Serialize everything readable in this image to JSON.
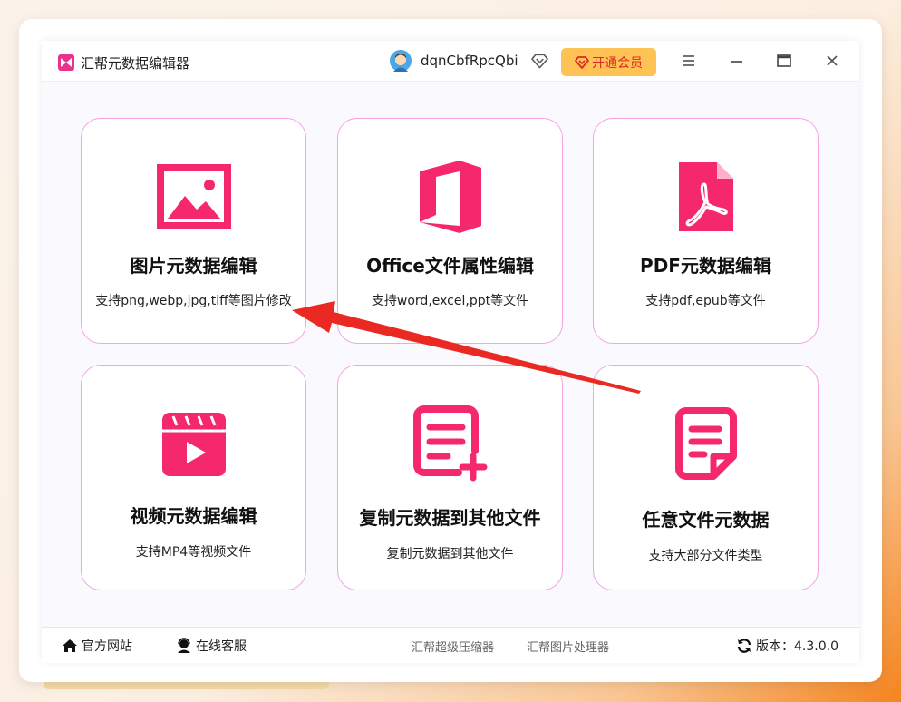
{
  "app": {
    "title": "汇帮元数据编辑器"
  },
  "user": {
    "name": "dqnCbfRpcQbi",
    "vip_label": "开通会员"
  },
  "cards": [
    {
      "title": "图片元数据编辑",
      "desc": "支持png,webp,jpg,tiff等图片修改",
      "icon": "image-icon"
    },
    {
      "title": "Office文件属性编辑",
      "desc": "支持word,excel,ppt等文件",
      "icon": "office-icon"
    },
    {
      "title": "PDF元数据编辑",
      "desc": "支持pdf,epub等文件",
      "icon": "pdf-icon"
    },
    {
      "title": "视频元数据编辑",
      "desc": "支持MP4等视频文件",
      "icon": "video-icon"
    },
    {
      "title": "复制元数据到其他文件",
      "desc": "复制元数据到其他文件",
      "icon": "copy-doc-icon"
    },
    {
      "title": "任意文件元数据",
      "desc": "支持大部分文件类型",
      "icon": "file-note-icon"
    }
  ],
  "footer": {
    "website": "官方网站",
    "support": "在线客服",
    "compressor": "汇帮超级压缩器",
    "image_tool": "汇帮图片处理器",
    "version": "版本：4.3.0.0"
  },
  "colors": {
    "accent": "#f5286e",
    "vip_bg": "#ffc254",
    "card_border": "#f5a3e6",
    "arrow": "#ea2a22"
  }
}
